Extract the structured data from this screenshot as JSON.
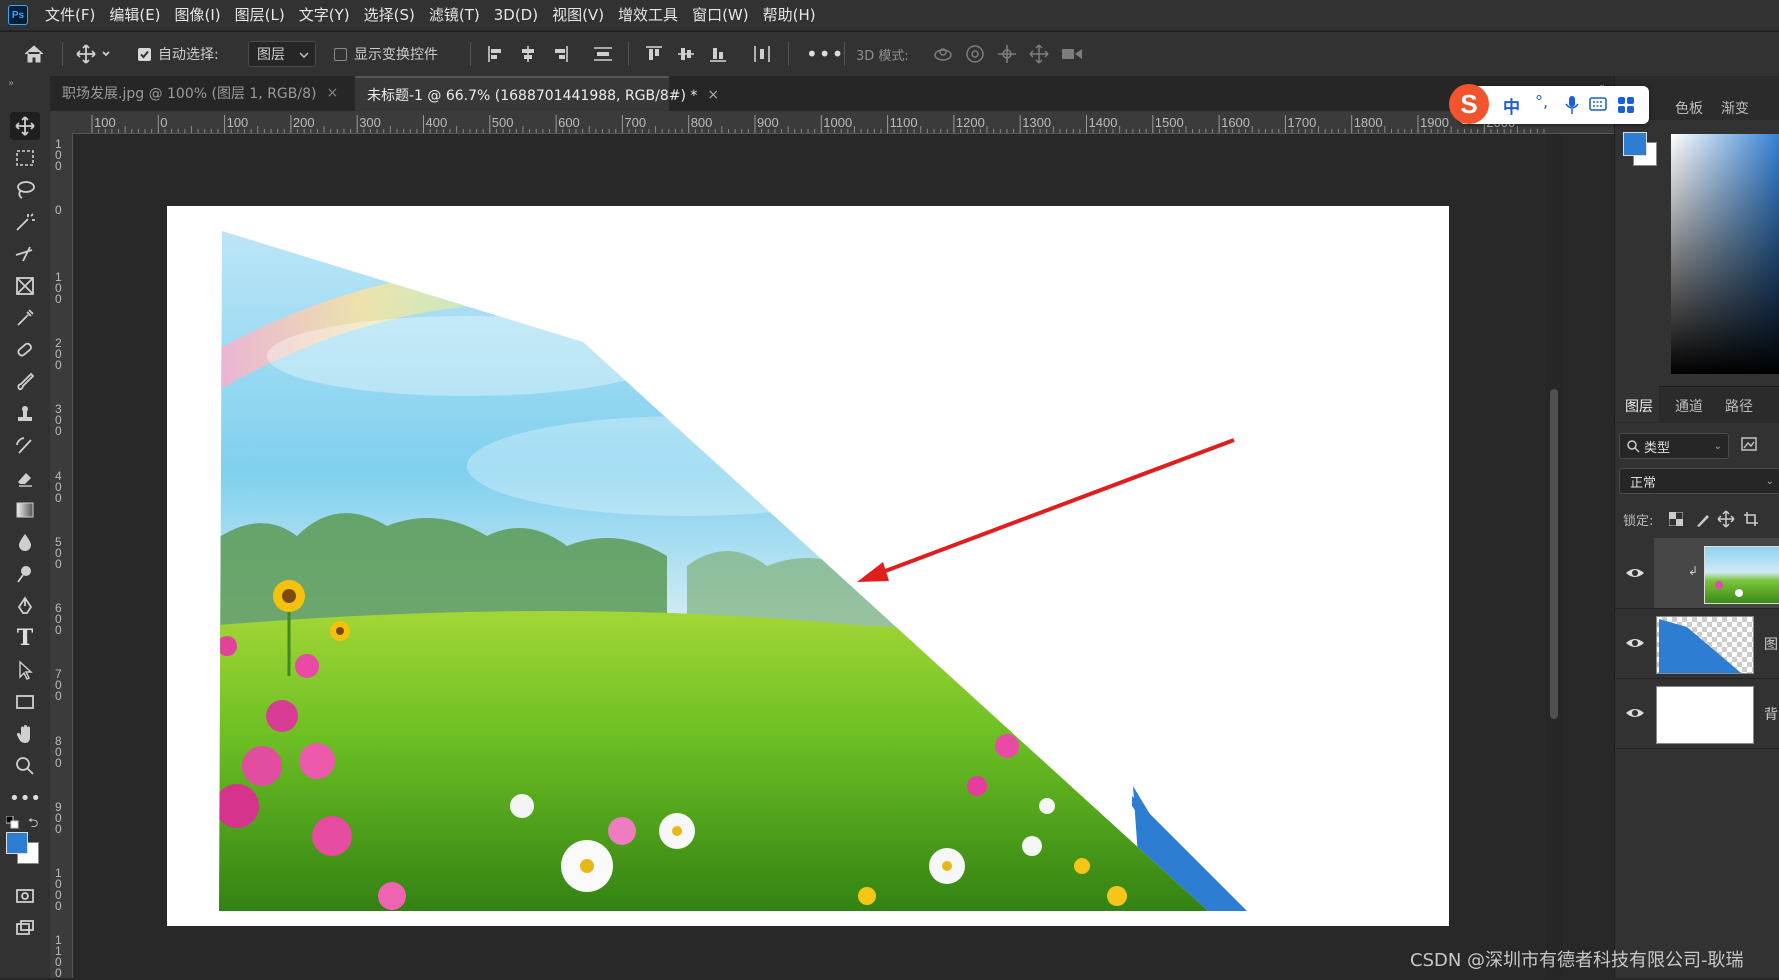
{
  "app": {
    "logo": "Ps"
  },
  "menu": [
    "文件(F)",
    "编辑(E)",
    "图像(I)",
    "图层(L)",
    "文字(Y)",
    "选择(S)",
    "滤镜(T)",
    "3D(D)",
    "视图(V)",
    "增效工具",
    "窗口(W)",
    "帮助(H)"
  ],
  "options": {
    "auto_select_label": "自动选择:",
    "auto_select_checked": true,
    "auto_select_target": "图层",
    "show_transform_label": "显示变换控件",
    "show_transform_checked": false,
    "mode_3d_label": "3D 模式:"
  },
  "tabs": [
    {
      "label": "职场发展.jpg @ 100% (图层 1, RGB/8)",
      "active": false
    },
    {
      "label": "未标题-1 @ 66.7% (1688701441988, RGB/8#) *",
      "active": true
    }
  ],
  "ruler": {
    "h_labels": [
      "100",
      "0",
      "100",
      "200",
      "300",
      "400",
      "500",
      "600",
      "700",
      "800",
      "900",
      "1000",
      "1100",
      "1200",
      "1300",
      "1400",
      "1500",
      "1600",
      "1700",
      "1800",
      "1900",
      "2000"
    ],
    "v_labels": [
      "100",
      "0",
      "100",
      "200",
      "300",
      "400",
      "500",
      "600",
      "700",
      "800",
      "900",
      "1000",
      "1100"
    ]
  },
  "right_panel": {
    "color_tabs": [
      "色板",
      "渐变"
    ],
    "layer_tabs": [
      "图层",
      "通道",
      "路径"
    ],
    "filter_label": "类型",
    "blend_mode": "正常",
    "lock_label": "锁定:",
    "layers": [
      {
        "thumb": "landscape",
        "label": "",
        "visible": true,
        "clipped": true
      },
      {
        "thumb": "blue-shape",
        "label": "图",
        "visible": true
      },
      {
        "thumb": "white",
        "label": "背",
        "visible": true
      }
    ]
  },
  "ime": {
    "mode": "中",
    "punct": "°,"
  },
  "colors": {
    "foreground": "#2d7dd2",
    "background": "#ffffff",
    "annotation_arrow": "#e01e1e",
    "shape_fill": "#2d7dd2"
  },
  "watermark": "CSDN @深圳市有德者科技有限公司-耿瑞"
}
